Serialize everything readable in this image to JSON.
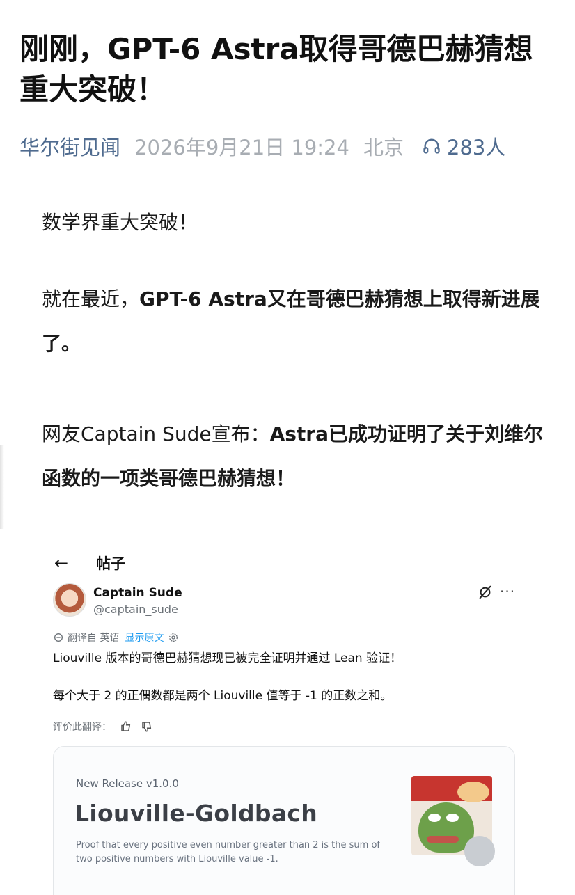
{
  "article": {
    "title": "刚刚，GPT-6 Astra取得哥德巴赫猜想重大突破！",
    "source": "华尔街见闻",
    "datetime": "2026年9月21日 19:24",
    "location": "北京",
    "listeners": "283人"
  },
  "body": {
    "p1": "数学界重大突破！",
    "p2_lead": "就在最近，",
    "p2_bold": "GPT-6 Astra又在哥德巴赫猜想上取得新进展了。",
    "p3_lead": "网友Captain Sude宣布：",
    "p3_bold": "Astra已成功证明了关于刘维尔函数的一项类哥德巴赫猜想！"
  },
  "embed": {
    "header_title": "帖子",
    "user_name": "Captain Sude",
    "user_handle": "@captain_sude",
    "translated_from": "翻译自 英语",
    "show_original": "显示原文",
    "tweet_line1": "Liouville 版本的哥德巴赫猜想现已被完全证明并通过 Lean 验证！",
    "tweet_line2": "每个大于 2 的正偶数都是两个 Liouville 值等于 -1 的正数之和。",
    "rate_translation": "评价此翻译：",
    "card": {
      "version": "New Release v1.0.0",
      "title": "Liouville-Goldbach",
      "description": "Proof that every positive even number greater than 2 is the sum of two positive numbers with Liouville value -1."
    }
  },
  "icons": {
    "headphone": "headphones-icon",
    "back": "back-arrow-icon",
    "grok": "grok-icon",
    "more": "more-icon",
    "translate": "translate-icon",
    "settings": "gear-icon",
    "thumbs_up": "thumbs-up-icon",
    "thumbs_down": "thumbs-down-icon",
    "github": "github-icon"
  },
  "colors": {
    "source_link": "#4f6b8f",
    "muted": "#a8adb3",
    "link_blue": "#1d9bf0"
  }
}
